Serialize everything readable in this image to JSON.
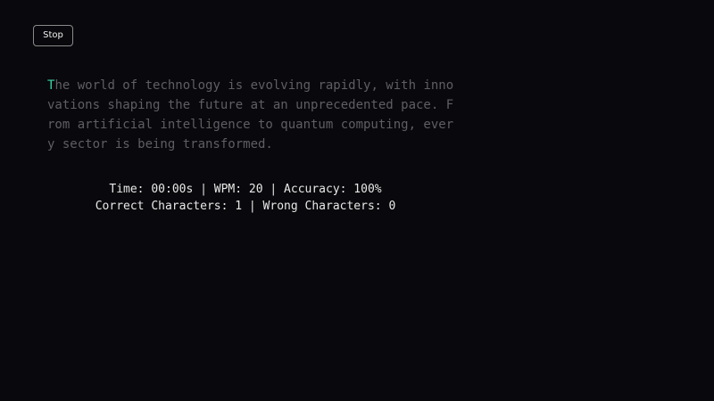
{
  "toolbar": {
    "stop_label": "Stop"
  },
  "passage": {
    "typed_correct": "T",
    "lines": [
      "he world of technology is evolving rapidly, with inno",
      "vations shaping the future at an unprecedented pace. F",
      "rom artificial intelligence to quantum computing, ever",
      "y sector is being transformed."
    ]
  },
  "stats": {
    "line1": "Time: 00:00s | WPM: 20 | Accuracy: 100%",
    "line2": "Correct Characters: 1 | Wrong Characters: 0"
  },
  "colors": {
    "background": "#09080c",
    "typed_correct": "#3ad6a6",
    "untyped": "#5f5f63",
    "stats_text": "#e8e8e8"
  }
}
